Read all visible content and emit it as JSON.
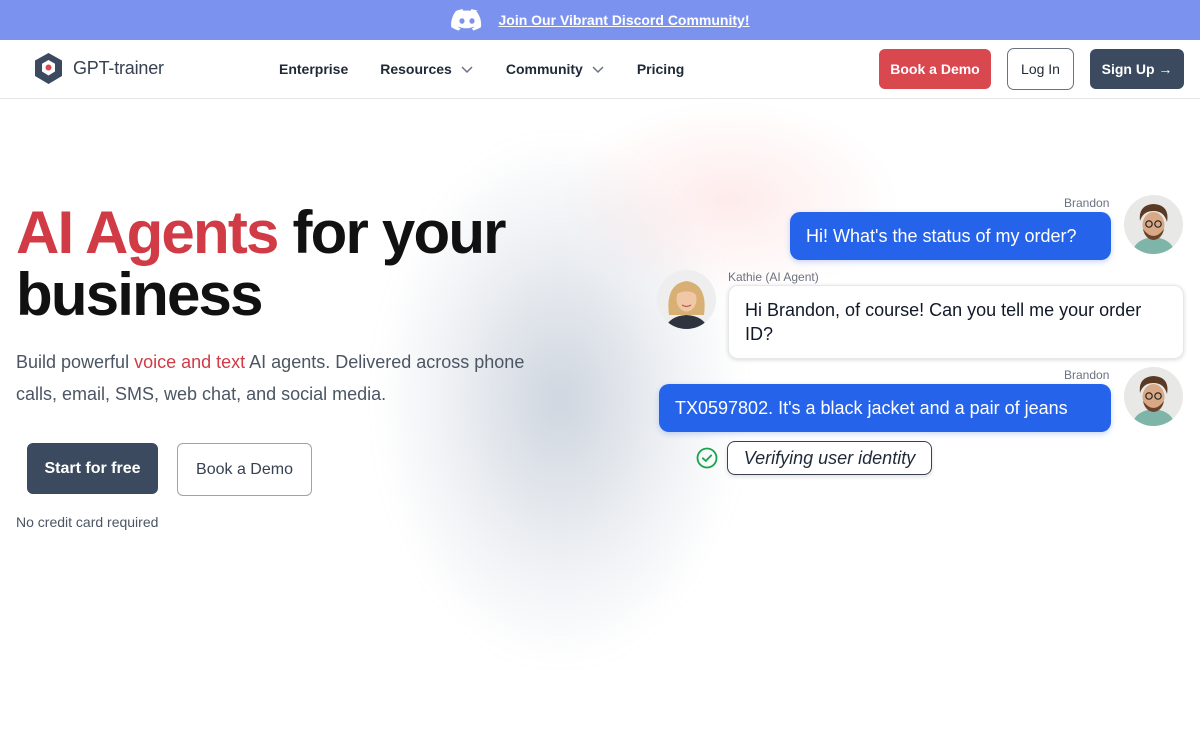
{
  "announcement": {
    "text": "Join Our Vibrant Discord Community!",
    "icon": "discord-icon"
  },
  "nav": {
    "brand": "GPT-trainer",
    "items": [
      {
        "label": "Enterprise",
        "dropdown": false
      },
      {
        "label": "Resources",
        "dropdown": true
      },
      {
        "label": "Community",
        "dropdown": true
      },
      {
        "label": "Pricing",
        "dropdown": false
      }
    ],
    "book_demo": "Book a Demo",
    "login": "Log In",
    "signup": "Sign Up →"
  },
  "hero": {
    "title_accent": "AI Agents",
    "title_rest": " for your business",
    "sub_before": "Build powerful ",
    "sub_accent": "voice and text",
    "sub_after": " AI agents. Delivered across phone calls, email, SMS, web chat, and social media.",
    "cta_primary": "Start for free",
    "cta_secondary": "Book a Demo",
    "note": "No credit card required"
  },
  "chat": {
    "messages": [
      {
        "sender": "Brandon",
        "role": "user",
        "text": "Hi! What's the status of my order?"
      },
      {
        "sender": "Kathie (AI Agent)",
        "role": "agent",
        "text": "Hi Brandon, of course! Can you tell me your order ID?"
      },
      {
        "sender": "Brandon",
        "role": "user",
        "text": "TX0597802. It's a black jacket and a pair of jeans"
      }
    ],
    "status": "Verifying user identity"
  },
  "colors": {
    "announce_bg": "#7b93ef",
    "accent_red": "#d03b45",
    "user_bubble": "#2563eb",
    "dark_button": "#3b4a5e",
    "verify_check": "#16a34a"
  }
}
